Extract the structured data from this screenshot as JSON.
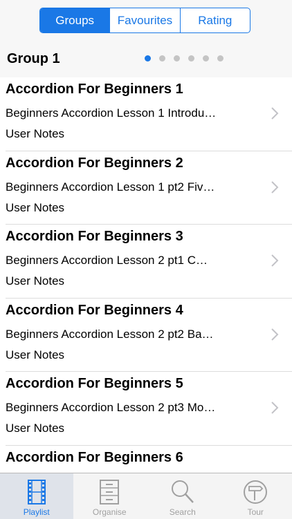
{
  "segments": [
    {
      "label": "Groups",
      "active": true
    },
    {
      "label": "Favourites",
      "active": false
    },
    {
      "label": "Rating",
      "active": false
    }
  ],
  "group": {
    "title": "Group 1",
    "page_count": 6,
    "current_page": 1
  },
  "items": [
    {
      "title": "Accordion For Beginners 1",
      "subtitle": "Beginners Accordion Lesson 1 Introdu…",
      "notes": "User Notes"
    },
    {
      "title": "Accordion For Beginners 2",
      "subtitle": "Beginners Accordion Lesson 1 pt2 Fiv…",
      "notes": "User Notes"
    },
    {
      "title": "Accordion For Beginners 3",
      "subtitle": "Beginners Accordion Lesson 2 pt1 C…",
      "notes": "User Notes"
    },
    {
      "title": "Accordion For Beginners 4",
      "subtitle": "Beginners Accordion Lesson 2 pt2 Ba…",
      "notes": "User Notes"
    },
    {
      "title": "Accordion For Beginners 5",
      "subtitle": "Beginners Accordion Lesson 2 pt3 Mo…",
      "notes": "User Notes"
    },
    {
      "title": "Accordion For Beginners 6",
      "subtitle": "",
      "notes": ""
    }
  ],
  "tabs": [
    {
      "label": "Playlist",
      "icon": "film-icon",
      "active": true
    },
    {
      "label": "Organise",
      "icon": "cabinet-icon",
      "active": false
    },
    {
      "label": "Search",
      "icon": "magnifier-icon",
      "active": false
    },
    {
      "label": "Tour",
      "icon": "signpost-icon",
      "active": false
    }
  ],
  "colors": {
    "accent": "#1a78e6",
    "inactive_tab": "#a0a0a0",
    "separator": "#dcdcdc"
  }
}
